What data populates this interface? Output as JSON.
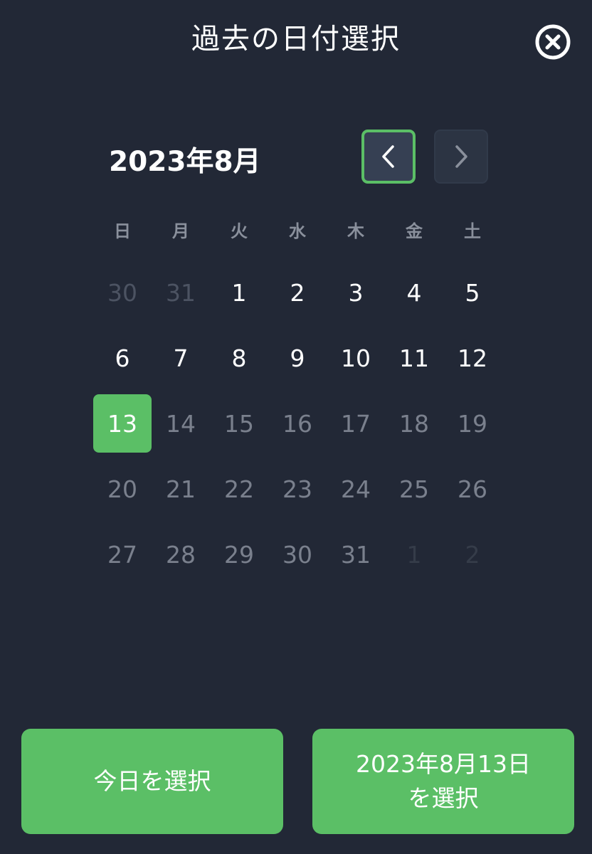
{
  "header": {
    "title": "過去の日付選択",
    "close_icon": "close-circle-icon"
  },
  "calendar": {
    "month_label": "2023年8月",
    "prev_icon": "chevron-left-icon",
    "next_icon": "chevron-right-icon",
    "weekdays": [
      "日",
      "月",
      "火",
      "水",
      "木",
      "金",
      "土"
    ],
    "selected_day": "13",
    "weeks": [
      [
        "30",
        "31",
        "1",
        "2",
        "3",
        "4",
        "5"
      ],
      [
        "6",
        "7",
        "8",
        "9",
        "10",
        "11",
        "12"
      ],
      [
        "13",
        "14",
        "15",
        "16",
        "17",
        "18",
        "19"
      ],
      [
        "20",
        "21",
        "22",
        "23",
        "24",
        "25",
        "26"
      ],
      [
        "27",
        "28",
        "29",
        "30",
        "31",
        "1",
        "2"
      ]
    ]
  },
  "actions": {
    "today_label": "今日を選択",
    "date_label_line1": "2023年8月13日",
    "date_label_line2": "を選択"
  },
  "colors": {
    "background": "#222836",
    "accent": "#5bbf66"
  }
}
